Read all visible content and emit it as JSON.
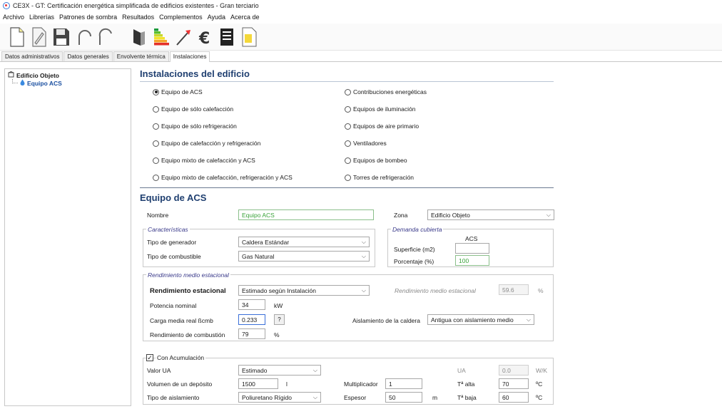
{
  "window": {
    "title": "CE3X - GT: Certificación energética simplificada de edificios existentes - Gran terciario"
  },
  "menu": [
    "Archivo",
    "Librerías",
    "Patrones de sombra",
    "Resultados",
    "Complementos",
    "Ayuda",
    "Acerca de"
  ],
  "toolbar_icons": [
    "new-file-icon",
    "open-file-icon",
    "save-icon",
    "undo-icon",
    "redo-icon",
    "building-icon",
    "energy-rating-icon",
    "improve-icon",
    "euro-icon",
    "report-icon",
    "certificate-icon"
  ],
  "tabs": [
    "Datos administrativos",
    "Datos generales",
    "Envolvente térmica",
    "Instalaciones"
  ],
  "active_tab": "Instalaciones",
  "tree": {
    "root": "Edificio Objeto",
    "child": "Equipo ACS"
  },
  "installations": {
    "title": "Instalaciones del edificio",
    "left_options": [
      "Equipo de ACS",
      "Equipo de sólo calefacción",
      "Equipo de sólo refrigeración",
      "Equipo de calefacción y refrigeración",
      "Equipo mixto de calefacción y ACS",
      "Equipo mixto de calefacción, refrigeración y ACS"
    ],
    "right_options": [
      "Contribuciones energéticas",
      "Equipos de iluminación",
      "Equipos de aire primario",
      "Ventiladores",
      "Equipos de bombeo",
      "Torres de refrigeración"
    ],
    "selected": "Equipo de ACS"
  },
  "acs": {
    "title": "Equipo de ACS",
    "nombre_label": "Nombre",
    "nombre_value": "Equipo ACS",
    "zona_label": "Zona",
    "zona_value": "Edificio Objeto",
    "caracteristicas_label": "Características",
    "tipo_generador_label": "Tipo de generador",
    "tipo_generador_value": "Caldera Estándar",
    "tipo_combustible_label": "Tipo de combustible",
    "tipo_combustible_value": "Gas Natural",
    "demanda_label": "Demanda cubierta",
    "acs_col_label": "ACS",
    "superficie_label": "Superficie (m2)",
    "superficie_value": "",
    "porcentaje_label": "Porcentaje (%)",
    "porcentaje_value": "100",
    "rendimiento_group_label": "Rendimiento medio estacional",
    "rendimiento_label": "Rendimiento estacional",
    "rendimiento_value": "Estimado según Instalación",
    "rend_medio_label": "Rendimiento medio estacional",
    "rend_medio_value": "59.6",
    "rend_medio_unit": "%",
    "potencia_label": "Potencia nominal",
    "potencia_value": "34",
    "potencia_unit": "kW",
    "carga_label": "Carga media real ßcmb",
    "carga_value": "0.233",
    "help_label": "?",
    "aislamiento_label": "Aislamiento de la caldera",
    "aislamiento_value": "Antigua con aislamiento medio",
    "rend_comb_label": "Rendimiento de combustión",
    "rend_comb_value": "79",
    "rend_comb_unit": "%",
    "acumulacion_label": "Con Acumulación",
    "acumulacion_checked": true,
    "valor_ua_label": "Valor UA",
    "valor_ua_value": "Estimado",
    "ua_label": "UA",
    "ua_value": "0.0",
    "ua_unit": "W/K",
    "volumen_label": "Volumen de un depósito",
    "volumen_value": "1500",
    "volumen_unit": "l",
    "multiplicador_label": "Multiplicador",
    "multiplicador_value": "1",
    "talta_label": "Tª alta",
    "talta_value": "70",
    "talta_unit": "ºC",
    "tipo_aislamiento_label": "Tipo de aislamiento",
    "tipo_aislamiento_value": "Poliuretano Rígido",
    "espesor_label": "Espesor",
    "espesor_value": "50",
    "espesor_unit": "m",
    "tbaja_label": "Tª baja",
    "tbaja_value": "60",
    "tbaja_unit": "ºC"
  }
}
